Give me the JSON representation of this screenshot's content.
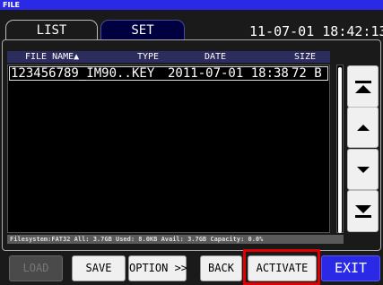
{
  "window": {
    "title": "FILE"
  },
  "tabs": [
    {
      "label": "LIST"
    },
    {
      "label": "SET"
    }
  ],
  "datetime": "11-07-01 18:42:13",
  "table": {
    "columns": [
      "FILE NAME▲",
      "TYPE",
      "DATE",
      "SIZE"
    ],
    "rows": [
      {
        "name": "123456789_IM90..",
        "type": "KEY",
        "date": "2011-07-01 18:38",
        "size": "72 B"
      }
    ]
  },
  "status_line": "Filesystem:FAT32 All: 3.7GB Used: 8.0KB Avail: 3.7GB Capacity: 0.0%",
  "buttons": {
    "load": "LOAD",
    "save": "SAVE",
    "option": "OPTION >>",
    "back": "BACK",
    "activate": "ACTIVATE",
    "exit": "EXIT"
  },
  "nav_icons": [
    "page-up-icon",
    "line-up-icon",
    "line-down-icon",
    "page-down-icon"
  ],
  "colors": {
    "title_bar": "#2a2ae6",
    "exit_button": "#2a2ae6",
    "highlight": "#e00000"
  }
}
